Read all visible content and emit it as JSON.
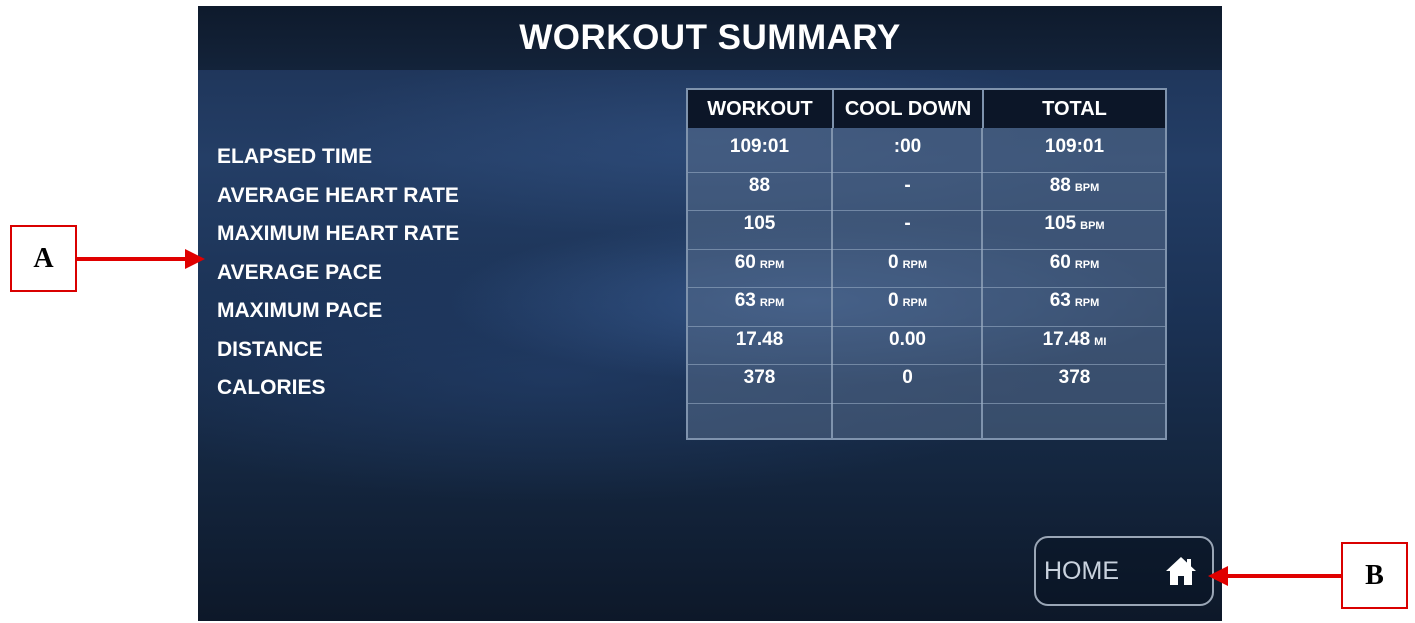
{
  "screen": {
    "title": "WORKOUT SUMMARY",
    "row_labels": [
      "ELAPSED TIME",
      "AVERAGE HEART RATE",
      "MAXIMUM HEART RATE",
      "AVERAGE PACE",
      "MAXIMUM PACE",
      "DISTANCE",
      "CALORIES"
    ],
    "columns": [
      "WORKOUT",
      "COOL DOWN",
      "TOTAL"
    ],
    "rows": [
      [
        {
          "v": "109:01",
          "u": ""
        },
        {
          "v": ":00",
          "u": ""
        },
        {
          "v": "109:01",
          "u": ""
        }
      ],
      [
        {
          "v": "88",
          "u": ""
        },
        {
          "v": "-",
          "u": ""
        },
        {
          "v": "88",
          "u": "BPM"
        }
      ],
      [
        {
          "v": "105",
          "u": ""
        },
        {
          "v": "-",
          "u": ""
        },
        {
          "v": "105",
          "u": "BPM"
        }
      ],
      [
        {
          "v": "60",
          "u": "RPM"
        },
        {
          "v": "0",
          "u": "RPM"
        },
        {
          "v": "60",
          "u": "RPM"
        }
      ],
      [
        {
          "v": "63",
          "u": "RPM"
        },
        {
          "v": "0",
          "u": "RPM"
        },
        {
          "v": "63",
          "u": "RPM"
        }
      ],
      [
        {
          "v": "17.48",
          "u": ""
        },
        {
          "v": "0.00",
          "u": ""
        },
        {
          "v": "17.48",
          "u": "MI"
        }
      ],
      [
        {
          "v": "378",
          "u": ""
        },
        {
          "v": "0",
          "u": ""
        },
        {
          "v": "378",
          "u": ""
        }
      ]
    ],
    "home_button": {
      "label": "HOME",
      "icon": "home-icon"
    }
  },
  "callouts": {
    "a": "A",
    "b": "B"
  },
  "colors": {
    "callout_border": "#d90000",
    "arrow": "#e00000",
    "header_bg": "#0c1628",
    "grid_border": "#7f93ad"
  }
}
